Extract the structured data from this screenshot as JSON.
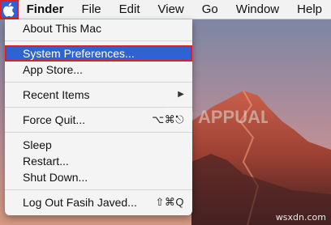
{
  "menubar": {
    "apple_icon": "apple-logo-icon",
    "items": [
      "Finder",
      "File",
      "Edit",
      "View",
      "Go",
      "Window",
      "Help"
    ]
  },
  "menu": {
    "about": "About This Mac",
    "system_prefs": "System Preferences...",
    "app_store": "App Store...",
    "recent_items": "Recent Items",
    "force_quit": "Force Quit...",
    "force_quit_shortcut": "⌥⌘⎋",
    "sleep": "Sleep",
    "restart": "Restart...",
    "shut_down": "Shut Down...",
    "log_out": "Log Out Fasih Javed...",
    "log_out_shortcut": "⇧⌘Q"
  },
  "watermark": "wsxdn.com",
  "colors": {
    "highlight": "#2f62d3",
    "annotation_border": "#e21f1f"
  }
}
